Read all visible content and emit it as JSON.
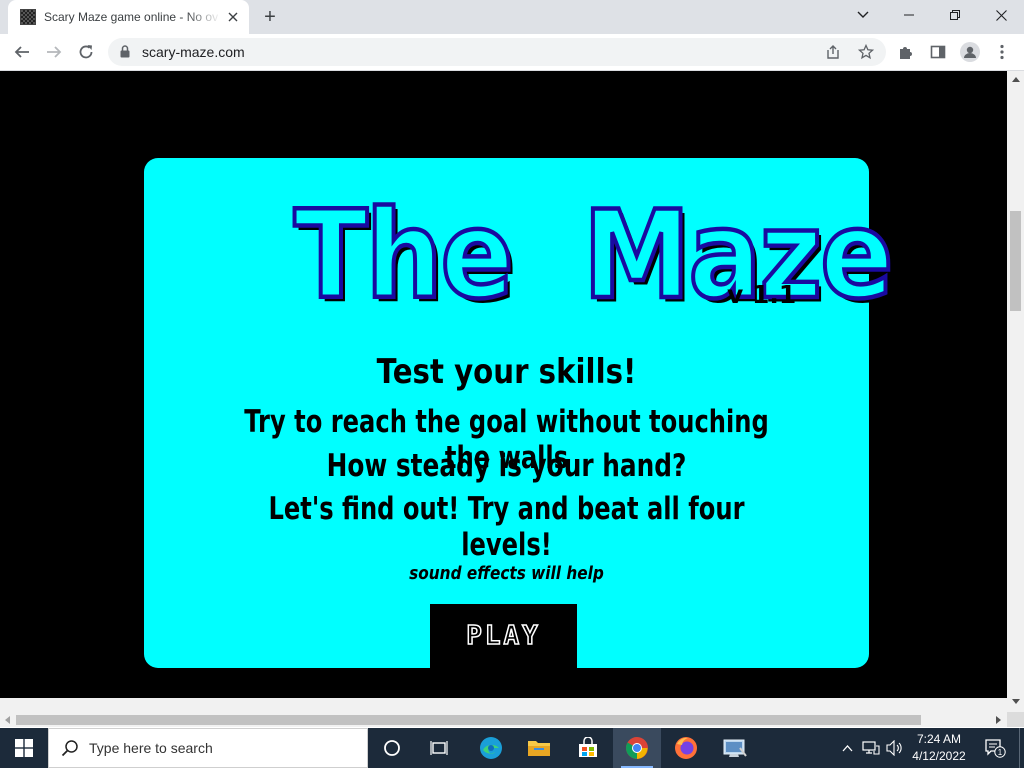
{
  "browser": {
    "tab_title": "Scary Maze game online - No ov",
    "new_tab_label": "+",
    "url": "scary-maze.com"
  },
  "game": {
    "title": "The  Maze",
    "version": "v 1.1",
    "headline": "Test your skills!",
    "line1": "Try to reach the goal without touching the walls",
    "line2": "How steady is your hand?",
    "line3": "Let's find out! Try and beat all four levels!",
    "hint": "sound effects will help",
    "play_label": "PLAY",
    "colors": {
      "panel": "#00ffff",
      "title_outline": "#1a0aa0",
      "background": "#000000"
    }
  },
  "taskbar": {
    "search_placeholder": "Type here to search",
    "time": "7:24 AM",
    "date": "4/12/2022",
    "notification_count": "1",
    "pinned": [
      "cortana-icon",
      "task-view-icon",
      "edge-icon",
      "file-explorer-icon",
      "store-icon",
      "chrome-icon",
      "firefox-icon",
      "control-panel-icon"
    ]
  }
}
